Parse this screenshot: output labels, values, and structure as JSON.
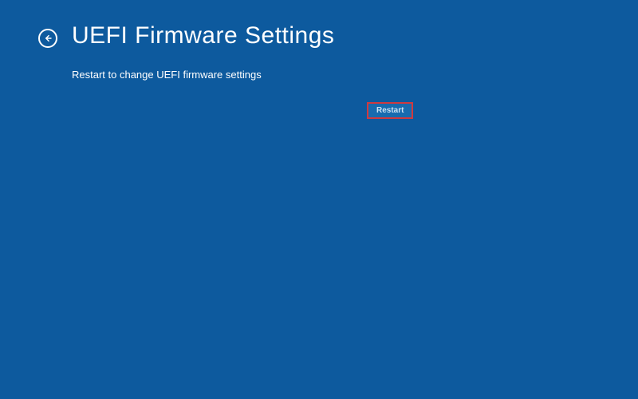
{
  "header": {
    "title": "UEFI Firmware Settings"
  },
  "body": {
    "instruction": "Restart to change UEFI firmware settings"
  },
  "actions": {
    "restart_label": "Restart"
  }
}
